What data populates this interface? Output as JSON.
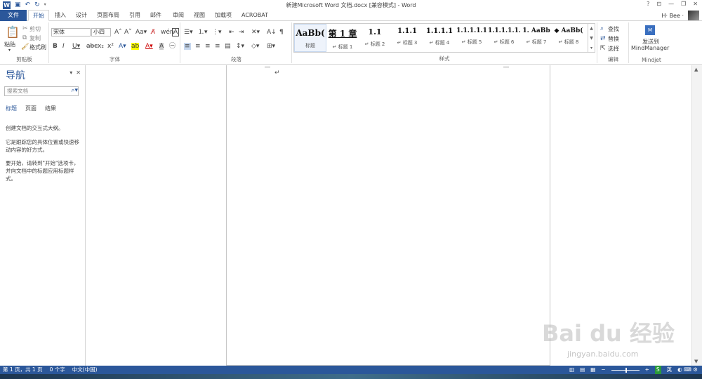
{
  "titlebar": {
    "document_title": "新建Microsoft Word 文档.docx [兼容模式] - Word",
    "word_logo": "W",
    "help": "?",
    "ribbon_opts": "⊡",
    "minimize": "—",
    "restore": "❐",
    "close": "✕"
  },
  "tabs": {
    "file": "文件",
    "home": "开始",
    "insert": "插入",
    "design": "设计",
    "layout": "页面布局",
    "references": "引用",
    "mailings": "邮件",
    "review": "审阅",
    "view": "视图",
    "addins": "加载项",
    "acrobat": "ACROBAT"
  },
  "user": {
    "name": "H· Bee ·"
  },
  "ribbon": {
    "clipboard": {
      "paste": "粘贴",
      "cut": "剪切",
      "copy": "复制",
      "format_painter": "格式刷",
      "label": "剪贴板"
    },
    "font": {
      "font_name": "宋体",
      "font_size": "小四",
      "label": "字体"
    },
    "paragraph": {
      "label": "段落"
    },
    "styles": {
      "label": "样式",
      "items": [
        {
          "sample": "AaBb(",
          "name": "标题"
        },
        {
          "sample": "第 1 章",
          "name": "↵ 标题 1"
        },
        {
          "sample": "1.1",
          "name": "↵ 标题 2"
        },
        {
          "sample": "1.1.1",
          "name": "↵ 标题 3"
        },
        {
          "sample": "1.1.1.1",
          "name": "↵ 标题 4"
        },
        {
          "sample": "1.1.1.1.1",
          "name": "↵ 标题 5"
        },
        {
          "sample": "1.1.1.1.1.",
          "name": "↵ 标题 6"
        },
        {
          "sample": "1. AaBb",
          "name": "↵ 标题 7"
        },
        {
          "sample": "◆ AaBb(",
          "name": "↵ 标题 8"
        }
      ]
    },
    "editing": {
      "find": "查找",
      "replace": "替换",
      "select": "选择",
      "label": "编辑"
    },
    "mindjet": {
      "send_line1": "发送到",
      "send_line2": "MindManager",
      "label": "Mindjet"
    }
  },
  "navpane": {
    "title": "导航",
    "search_placeholder": "搜索文档",
    "tabs": [
      "标题",
      "页面",
      "结果"
    ],
    "para1": "创建文档的交互式大纲。",
    "para2": "它是跟踪您的具体位置或快速移动内容的好方式。",
    "para3": "要开始，请转到\"开始\"选项卡，并向文档中的标题应用标题样式。"
  },
  "statusbar": {
    "page": "第 1 页，共 1 页",
    "words": "0 个字",
    "language": "中文(中国)"
  },
  "watermark": {
    "text": "Bai du 经验",
    "sub": "jingyan.baidu.com"
  }
}
